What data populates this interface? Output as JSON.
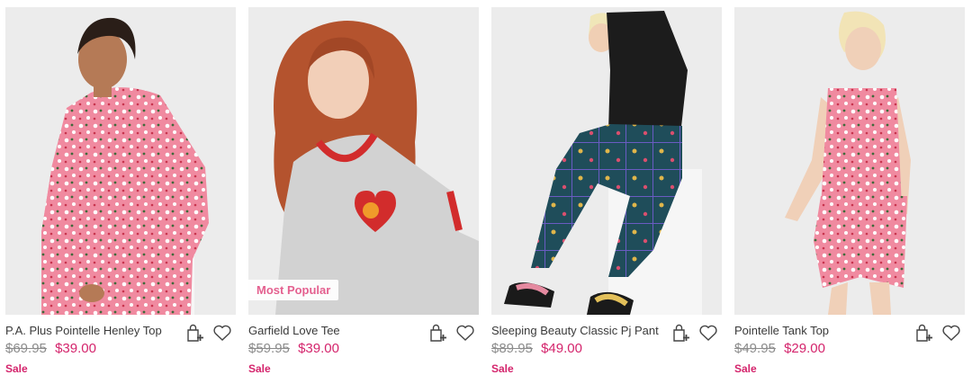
{
  "products": [
    {
      "name": "P.A. Plus Pointelle Henley Top",
      "original_price": "$69.95",
      "sale_price": "$39.00",
      "sale_label": "Sale",
      "badge": "",
      "icons": [
        "add-to-bag-icon",
        "heart-icon"
      ]
    },
    {
      "name": "Garfield Love Tee",
      "original_price": "$59.95",
      "sale_price": "$39.00",
      "sale_label": "Sale",
      "badge": "Most Popular",
      "icons": [
        "add-to-bag-icon",
        "heart-icon"
      ]
    },
    {
      "name": "Sleeping Beauty Classic Pj Pant",
      "original_price": "$89.95",
      "sale_price": "$49.00",
      "sale_label": "Sale",
      "badge": "",
      "icons": [
        "add-to-bag-icon",
        "heart-icon"
      ]
    },
    {
      "name": "Pointelle Tank Top",
      "original_price": "$49.95",
      "sale_price": "$29.00",
      "sale_label": "Sale",
      "badge": "",
      "icons": [
        "add-to-bag-icon",
        "heart-icon"
      ]
    }
  ],
  "colors": {
    "sale": "#d4246c",
    "original_price": "#8c8c8c",
    "badge_text": "#e4608f",
    "photo_background": "#ececec"
  }
}
